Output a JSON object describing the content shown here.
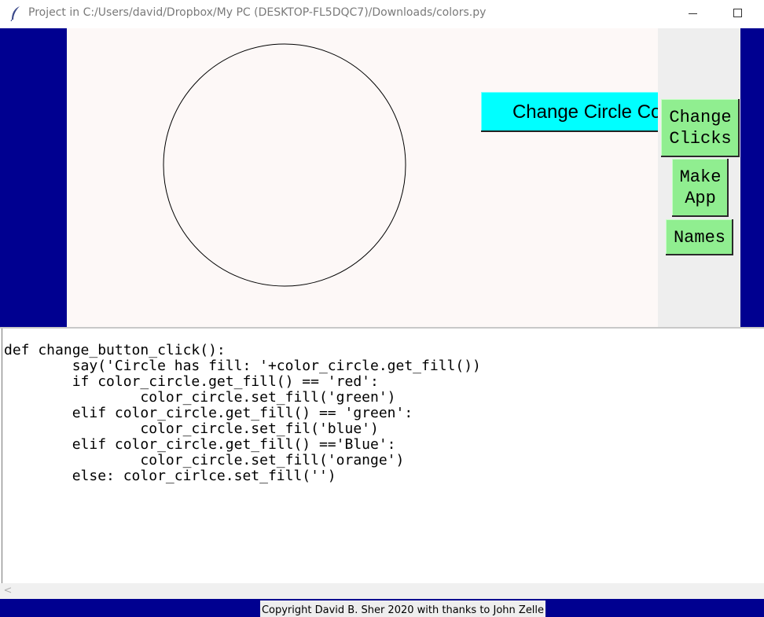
{
  "window": {
    "title": "Project in C:/Users/david/Dropbox/My PC (DESKTOP-FL5DQC7)/Downloads/colors.py",
    "icon": "feather-icon"
  },
  "canvas": {
    "change_color_button": "Change Circle Color",
    "circle_fill": ""
  },
  "side_panel": {
    "change_clicks_label": "Change\nClicks",
    "make_app_label": "Make\nApp",
    "names_label": "Names"
  },
  "code": {
    "text": "def change_button_click():\n\tsay('Circle has fill: '+color_circle.get_fill())\n\tif color_circle.get_fill() == 'red':\n\t\tcolor_circle.set_fill('green')\n\telif color_circle.get_fill() == 'green':\n\t\tcolor_circle.set_fil('blue')\n\telif color_circle.get_fill() =='Blue':\n\t\tcolor_circle.set_fill('orange')\n\telse: color_cirlce.set_fill('')"
  },
  "scrollbar": {
    "left_arrow": "<"
  },
  "footer": {
    "copyright": "Copyright David B. Sher 2020 with thanks to John Zelle"
  },
  "colors": {
    "frame_blue": "#000090",
    "canvas_bg": "#fdf8f7",
    "color_button": "#00ffff",
    "green_button": "#90ee90",
    "side_panel": "#eeeeee"
  }
}
